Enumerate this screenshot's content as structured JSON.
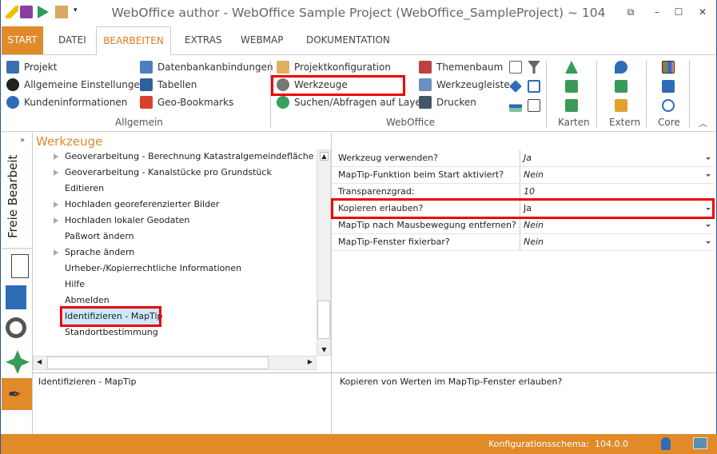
{
  "window": {
    "title": "WebOffice author - WebOffice Sample Project (WebOffice_SampleProject) ~ 104"
  },
  "quick_access": [
    "pencil-icon",
    "save-icon",
    "run-icon",
    "close-project-icon",
    "customize-dropdown-icon"
  ],
  "tabs": [
    {
      "label": "START"
    },
    {
      "label": "DATEI"
    },
    {
      "label": "BEARBEITEN"
    },
    {
      "label": "EXTRAS"
    },
    {
      "label": "WEBMAP"
    },
    {
      "label": "DOKUMENTATION"
    }
  ],
  "ribbon": {
    "allgemein": {
      "label": "Allgemein",
      "items": [
        "Projekt",
        "Allgemeine Einstellungen",
        "Kundeninformationen",
        "Datenbankanbindungen",
        "Tabellen",
        "Geo-Bookmarks"
      ]
    },
    "weboffice": {
      "label": "WebOffice",
      "items": [
        "Projektkonfiguration",
        "Werkzeuge",
        "Suchen/Abfragen auf Layer",
        "Themenbaum",
        "Werkzeugleiste",
        "Drucken"
      ]
    },
    "karten": {
      "label": "Karten"
    },
    "extern": {
      "label": "Extern"
    },
    "core": {
      "label": "Core"
    }
  },
  "sidebar": {
    "label": "Freie Bearbeit",
    "expand": "»"
  },
  "panel": {
    "title": "Werkzeuge"
  },
  "tree": [
    {
      "label": "Geoverarbeitung - Berechnung Katastralgemeindefläche",
      "expandable": true
    },
    {
      "label": "Geoverarbeitung - Kanalstücke pro Grundstück",
      "expandable": true
    },
    {
      "label": "Editieren",
      "expandable": false
    },
    {
      "label": "Hochladen georeferenzierter Bilder",
      "expandable": true
    },
    {
      "label": "Hochladen lokaler Geodaten",
      "expandable": true
    },
    {
      "label": "Paßwort ändern",
      "expandable": false
    },
    {
      "label": "Sprache ändern",
      "expandable": true
    },
    {
      "label": "Urheber-/Kopierrechtliche Informationen",
      "expandable": false
    },
    {
      "label": "Hilfe",
      "expandable": false
    },
    {
      "label": "Abmelden",
      "expandable": false
    },
    {
      "label": "Identifizieren - MapTip",
      "expandable": false,
      "selected": true
    },
    {
      "label": "Standortbestimmung",
      "expandable": false
    }
  ],
  "properties": [
    {
      "name": "Werkzeug verwenden?",
      "value": "Ja",
      "dropdown": true
    },
    {
      "name": "MapTip-Funktion beim Start aktiviert?",
      "value": "Nein",
      "dropdown": true
    },
    {
      "name": "Transparenzgrad:",
      "value": "10",
      "dropdown": false
    },
    {
      "name": "Kopieren erlauben?",
      "value": "Ja",
      "dropdown": true,
      "highlighted": true
    },
    {
      "name": "MapTip nach Mausbewegung entfernen?",
      "value": "Nein",
      "dropdown": true
    },
    {
      "name": "MapTip-Fenster fixierbar?",
      "value": "Nein",
      "dropdown": true
    }
  ],
  "description": {
    "left": "Identifizieren - MapTip",
    "right": "Kopieren von Werten im MapTip-Fenster erlauben?"
  },
  "status": {
    "text": "Konfigurationsschema:  104.0.0"
  },
  "colors": {
    "accent": "#e08a2a",
    "highlight": "#e00000",
    "selection": "#cce8ff"
  }
}
